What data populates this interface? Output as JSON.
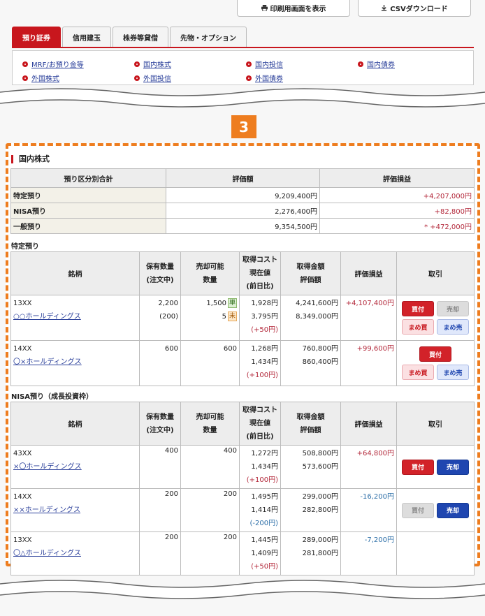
{
  "top_buttons": {
    "print": "印刷用画面を表示",
    "csv": "CSVダウンロード"
  },
  "tabs": [
    "預り証券",
    "信用建玉",
    "株券等貸借",
    "先物・オプション"
  ],
  "links": [
    "MRF/お預り金等",
    "国内株式",
    "国内投信",
    "国内債券",
    "外国株式",
    "外国投信",
    "外国債券"
  ],
  "step": "3",
  "section_title": "国内株式",
  "summary": {
    "headers": [
      "預り区分別合計",
      "評価額",
      "評価損益"
    ],
    "rows": [
      {
        "label": "特定預り",
        "value": "9,209,400円",
        "pl": "+4,207,000円"
      },
      {
        "label": "NISA預り",
        "value": "2,276,400円",
        "pl": "+82,800円"
      },
      {
        "label": "一般預り",
        "value": "9,354,500円",
        "pl": "* +472,000円"
      }
    ]
  },
  "holdings_headers": {
    "name": "銘柄",
    "qty": "保有数量",
    "qty2": "(注文中)",
    "sellable": "売却可能",
    "sellable2": "数量",
    "cost": "取得コスト",
    "cost2": "現在値",
    "cost3": "(前日比)",
    "amount": "取得金額",
    "amount2": "評価額",
    "pl": "評価損益",
    "trade": "取引"
  },
  "tokutei": {
    "title": "特定預り",
    "rows": [
      {
        "code": "13XX",
        "name": "○○ホールディングス",
        "qty": "2,200",
        "order": "(200)",
        "sell1": "1,500",
        "tag1": "単",
        "sell2": "5",
        "tag2": "未",
        "cost": "1,928円",
        "price": "3,795円",
        "change": "(+50円)",
        "amount": "4,241,600円",
        "eval": "8,349,000円",
        "pl": "+4,107,400円"
      },
      {
        "code": "14XX",
        "name": "〇×ホールディングス",
        "qty": "600",
        "sell1": "600",
        "cost": "1,268円",
        "price": "1,434円",
        "change": "(+100円)",
        "amount": "760,800円",
        "eval": "860,400円",
        "pl": "+99,600円"
      }
    ]
  },
  "nisa": {
    "title": "NISA預り（成長投資枠）",
    "rows": [
      {
        "code": "43XX",
        "name": "×〇ホールディングス",
        "qty": "400",
        "sell1": "400",
        "cost": "1,272円",
        "price": "1,434円",
        "change": "(+100円)",
        "amount": "508,800円",
        "eval": "573,600円",
        "pl": "+64,800円"
      },
      {
        "code": "14XX",
        "name": "××ホールディングス",
        "qty": "200",
        "sell1": "200",
        "cost": "1,495円",
        "price": "1,414円",
        "change": "(-200円)",
        "amount": "299,000円",
        "eval": "282,800円",
        "pl": "-16,200円"
      },
      {
        "code": "13XX",
        "name": "〇△ホールディングス",
        "qty": "200",
        "sell1": "200",
        "cost": "1,445円",
        "price": "1,409円",
        "change": "(+50円)",
        "amount": "289,000円",
        "eval": "281,800円",
        "pl": "-7,200円"
      }
    ]
  },
  "buttons": {
    "buy": "買付",
    "sell": "売却",
    "mbuy": "まめ買",
    "msell": "まめ売"
  },
  "colors": {
    "brand_red": "#c8161d",
    "orange": "#ee7d1f",
    "buy": "#d22229",
    "sell": "#1f46b0"
  }
}
